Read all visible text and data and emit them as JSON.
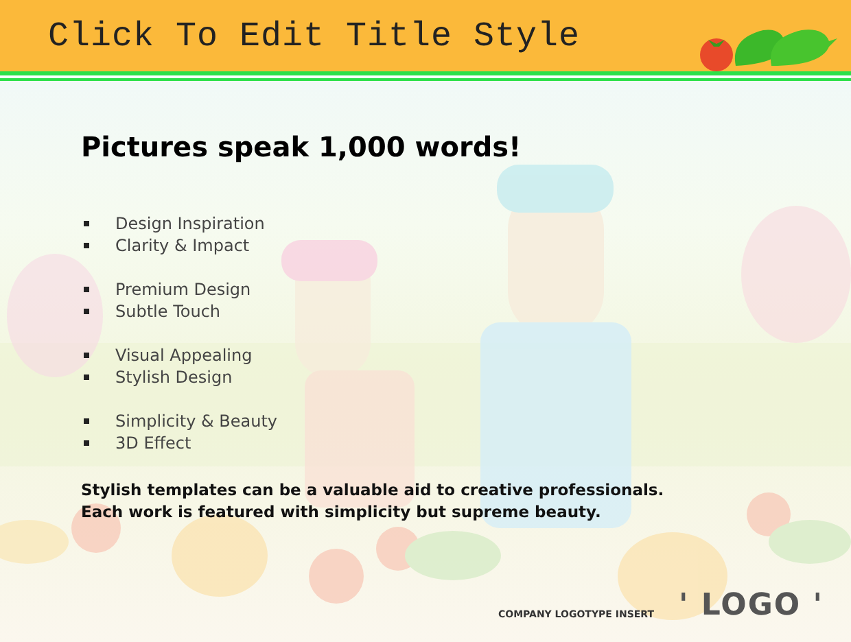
{
  "slide": {
    "title": "Click To Edit Title Style",
    "heading": "Pictures speak 1,000 words!",
    "bullet_groups": [
      [
        "Design Inspiration",
        "Clarity & Impact"
      ],
      [
        "Premium Design",
        "Subtle Touch"
      ],
      [
        "Visual Appealing",
        "Stylish Design"
      ],
      [
        "Simplicity & Beauty",
        "3D Effect"
      ]
    ],
    "body_lines": [
      "Stylish templates can be a valuable aid to creative professionals.",
      "Each work is featured with simplicity but supreme beauty."
    ]
  },
  "logo": {
    "tagline": "COMPANY LOGOTYPE INSERT",
    "mark": "' LOGO '"
  }
}
